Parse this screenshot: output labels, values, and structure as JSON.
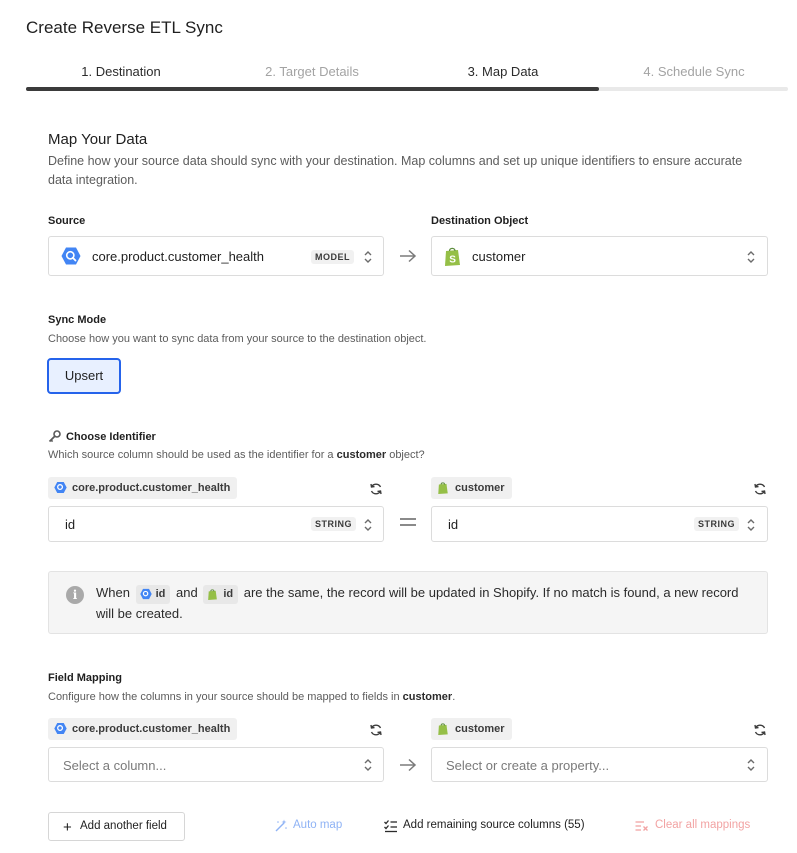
{
  "page": {
    "title": "Create Reverse ETL Sync"
  },
  "steps": [
    {
      "label": "1. Destination",
      "state": "complete"
    },
    {
      "label": "2. Target Details",
      "state": "inactive"
    },
    {
      "label": "3. Map Data",
      "state": "current"
    },
    {
      "label": "4. Schedule Sync",
      "state": "inactive"
    }
  ],
  "map": {
    "title": "Map Your Data",
    "description": "Define how your source data should sync with your destination. Map columns and set up unique identifiers to ensure accurate data integration."
  },
  "source": {
    "label": "Source",
    "value": "core.product.customer_health",
    "tag": "MODEL",
    "icon": "bigquery-icon"
  },
  "destination": {
    "label": "Destination Object",
    "value": "customer",
    "icon": "shopify-icon"
  },
  "sync_mode": {
    "label": "Sync Mode",
    "description": "Choose how you want to sync data from your source to the destination object.",
    "option": "Upsert"
  },
  "identifier": {
    "icon": "key-icon",
    "label": "Choose Identifier",
    "desc_before": "Which source column should be used as the identifier for a ",
    "desc_object": "customer",
    "desc_after": " object?",
    "source_chip": "core.product.customer_health",
    "dest_chip": "customer",
    "source_value": "id",
    "source_type": "STRING",
    "dest_value": "id",
    "dest_type": "STRING"
  },
  "info": {
    "when": "When",
    "source_field": "id",
    "and": "and",
    "dest_field": "id",
    "rest": "are the same, the record will be updated in Shopify. If no match is found, a new record will be created."
  },
  "field_mapping": {
    "label": "Field Mapping",
    "desc_before": "Configure how the columns in your source should be mapped to fields in ",
    "desc_object": "customer",
    "desc_after": ".",
    "source_chip": "core.product.customer_health",
    "dest_chip": "customer",
    "source_placeholder": "Select a column...",
    "dest_placeholder": "Select or create a property..."
  },
  "actions": {
    "add_field": "Add another field",
    "auto_map": "Auto map",
    "add_remaining": "Add remaining source columns (55)",
    "clear_all": "Clear all mappings"
  },
  "colors": {
    "accent": "#2563eb",
    "bigquery": "#4285f4",
    "shopify": "#95bf47",
    "disabled_blue": "#8fb3f5",
    "disabled_red": "#f2a3a3"
  }
}
